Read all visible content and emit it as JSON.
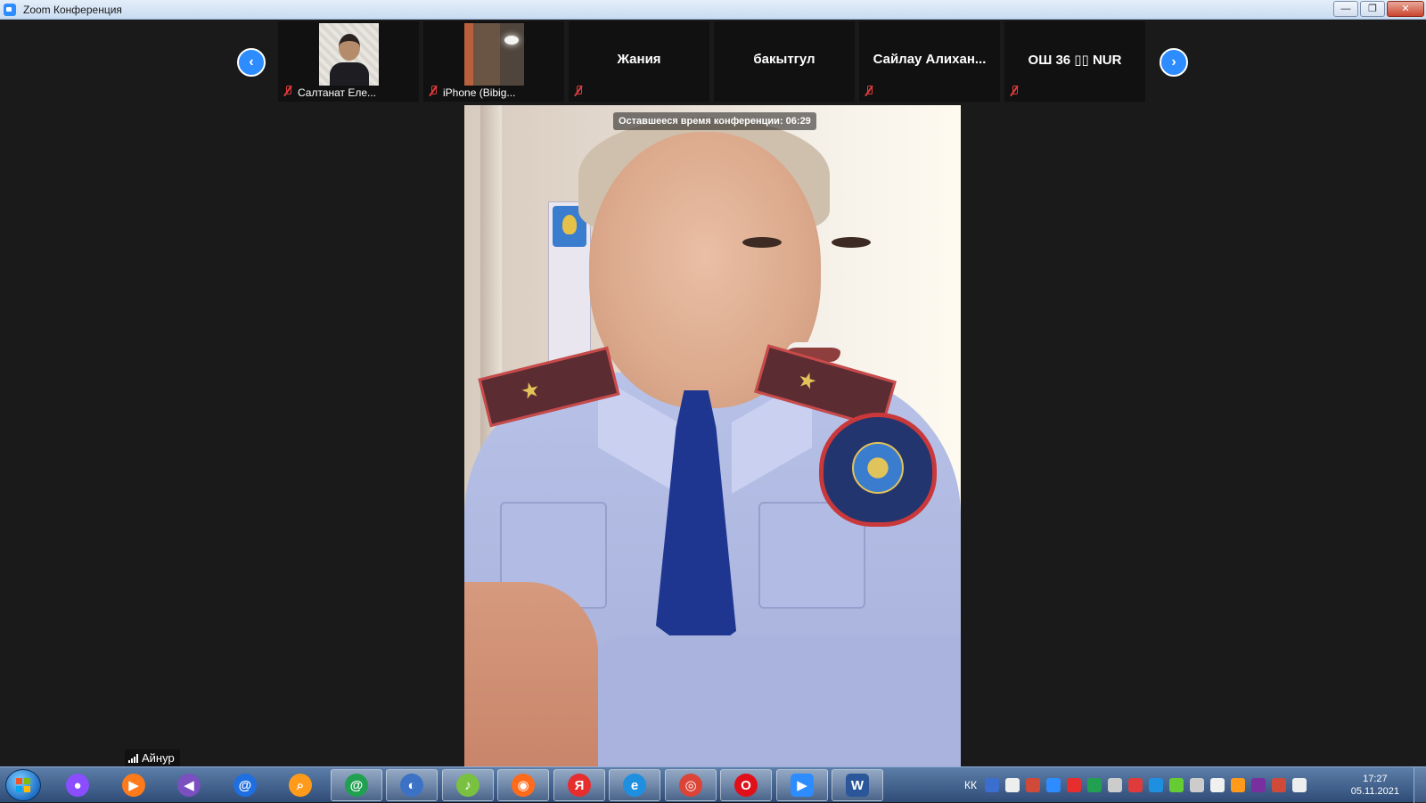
{
  "window": {
    "title": "Zoom Конференция",
    "controls": {
      "minimize": "—",
      "restore": "❐",
      "close": "✕"
    }
  },
  "participants": [
    {
      "name": "Салтанат Еле...",
      "muted": true,
      "has_video": true,
      "thumb": "person"
    },
    {
      "name": "iPhone (Bibig...",
      "muted": true,
      "has_video": true,
      "thumb": "room"
    },
    {
      "name": "Жания",
      "muted": true,
      "has_video": false
    },
    {
      "name": "бакытгул",
      "muted": false,
      "has_video": false
    },
    {
      "name": "Сайлау  Алихан...",
      "muted": true,
      "has_video": false
    },
    {
      "name": "ОШ 36 ▯▯   NUR",
      "muted": true,
      "has_video": false
    }
  ],
  "nav": {
    "prev": "‹",
    "next": "›"
  },
  "main_video": {
    "overlay_text": "Оставшееся время конференции: 06:29"
  },
  "speaker": {
    "name": "Айнур"
  },
  "taskbar": {
    "apps": [
      {
        "name": "alice",
        "color": "#8a4dff",
        "glyph": "●"
      },
      {
        "name": "media",
        "color": "#ff7a1a",
        "glyph": "▶"
      },
      {
        "name": "vs",
        "color": "#7a4fbf",
        "glyph": "◀"
      },
      {
        "name": "mail",
        "color": "#1f6fe0",
        "glyph": "@"
      },
      {
        "name": "search",
        "color": "#ff9a1a",
        "glyph": "⌕"
      },
      {
        "name": "agent",
        "color": "#20a050",
        "glyph": "@"
      },
      {
        "name": "firefox-old",
        "color": "#3b72c6",
        "glyph": "◐"
      },
      {
        "name": "music",
        "color": "#7ac142",
        "glyph": "♪"
      },
      {
        "name": "firefox",
        "color": "#ff6b1a",
        "glyph": "◉"
      },
      {
        "name": "yandex",
        "color": "#e62e2e",
        "glyph": "Я"
      },
      {
        "name": "ie",
        "color": "#1f8fe0",
        "glyph": "e"
      },
      {
        "name": "chrome",
        "color": "#db4437",
        "glyph": "◎"
      },
      {
        "name": "opera",
        "color": "#e0101a",
        "glyph": "O"
      },
      {
        "name": "zoom",
        "color": "#2d8cff",
        "glyph": "▶"
      },
      {
        "name": "word",
        "color": "#2b579a",
        "glyph": "W"
      }
    ],
    "lang": "КК",
    "clock": {
      "time": "17:27",
      "date": "05.11.2021"
    },
    "tray_colors": [
      "#3a6fd0",
      "#eeeeee",
      "#d04a3a",
      "#2d8cff",
      "#e62e2e",
      "#20a050",
      "#cccccc",
      "#e03b3b",
      "#1f8fe0",
      "#66cc33",
      "#cccccc",
      "#f0f0f0",
      "#ff9a1a",
      "#7a2fa0",
      "#d04a3a",
      "#eeeeee"
    ]
  }
}
